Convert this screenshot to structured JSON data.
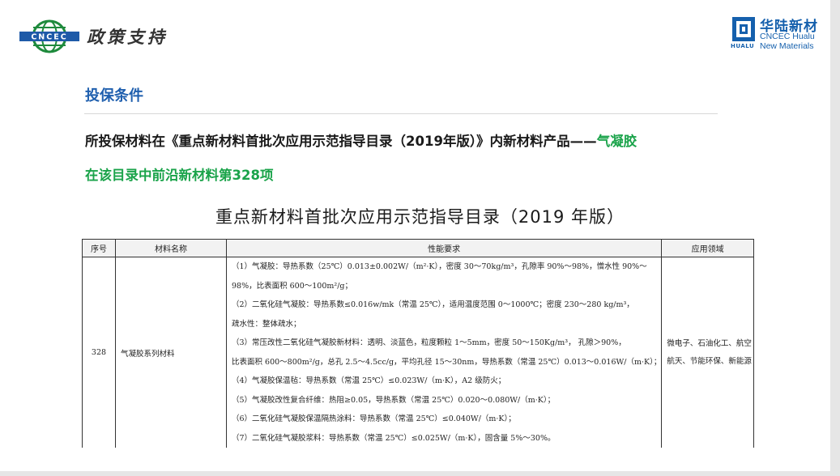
{
  "header": {
    "logo_text": "CNCEC",
    "policy_title": "政策支持",
    "brand_cn": "华陆新材",
    "brand_en_1": "CNCEC Hualu",
    "brand_en_2": "New Materials",
    "brand_sub": "HUALU"
  },
  "section": {
    "title": "投保条件"
  },
  "statement": {
    "line1_main": "所投保材料在《重点新材料首批次应用示范指导目录（2019年版）》内新材料产品——",
    "line1_highlight": "气凝胶",
    "line2": "在该目录中前沿新材料第328项"
  },
  "catalog": {
    "title": "重点新材料首批次应用示范指导目录（2019 年版）",
    "headers": [
      "序号",
      "材料名称",
      "性能要求",
      "应用领域"
    ],
    "row": {
      "no": "328",
      "name": "气凝胶系列材料",
      "requirements": [
        "（1）气凝胶：导热系数（25℃）0.013±0.002W/（m²·K），密度 30～70kg/m³，孔隙率 90%～98%，憎水性 90%～",
        "98%，比表面积 600～100m²/g；",
        "（2）二氧化硅气凝胶：导热系数≤0.016w/mk（常温 25℃），适用温度范围 0～1000℃；密度 230～280 kg/m³，",
        "疏水性：整体疏水；",
        "（3）常压改性二氧化硅气凝胶新材料：透明、淡蓝色，粒度颗粒 1～5mm，密度 50～150Kg/m³，  孔隙＞90%，",
        "比表面积 600～800m²/g，总孔 2.5～4.5cc/g，平均孔径 15～30nm，导热系数（常温 25℃）0.013～0.016W/（m·K）；",
        "（4）气凝胶保温毡：导热系数（常温 25℃）≤0.023W/（m·K），A2 级防火；",
        "（5）气凝胶改性复合纤维：热阻≥0.05，导热系数（常温 25℃）0.020～0.080W/（m·K）；",
        "（6）二氧化硅气凝胶保温隔热涂料：导热系数（常温 25℃）≤0.040W/（m·K）；",
        "（7）二氧化硅气凝胶浆料：导热系数（常温 25℃）≤0.025W/（m·K），固含量 5%～30%。"
      ],
      "application": "微电子、石油化工、航空航天、节能环保、新能源"
    }
  },
  "colors": {
    "title_blue": "#1f5fae",
    "highlight_green": "#1aa34a",
    "brand_blue": "#1560ad"
  }
}
